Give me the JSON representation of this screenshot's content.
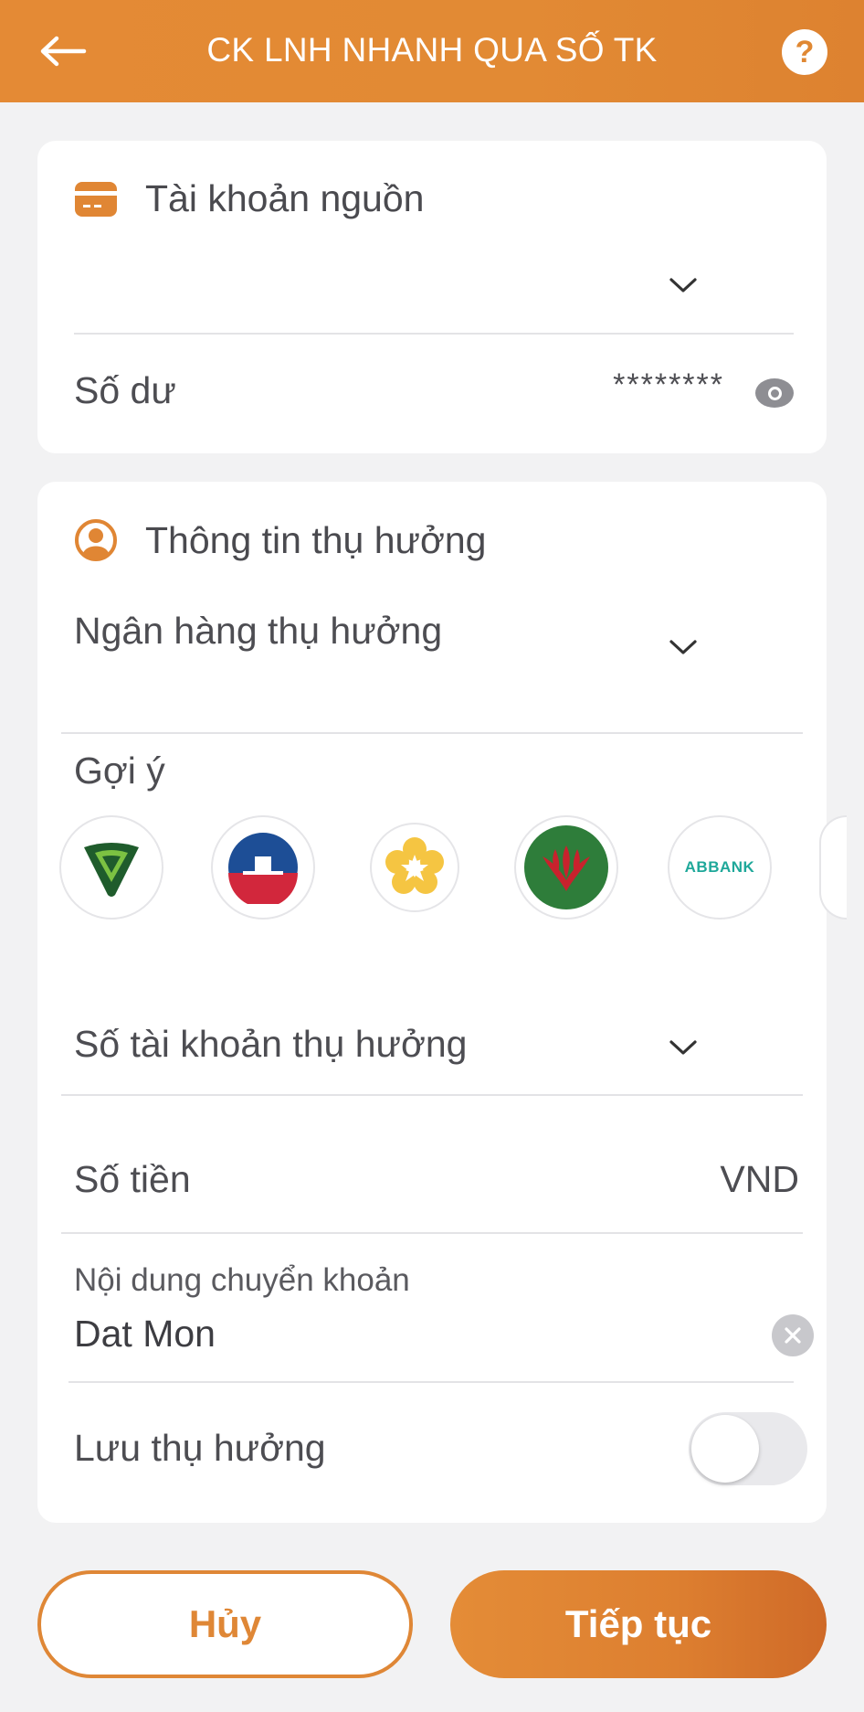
{
  "header": {
    "title": "CK LNH NHANH QUA SỐ TK",
    "help_label": "?"
  },
  "source_account": {
    "section_title": "Tài khoản nguồn",
    "balance_label": "Số dư",
    "balance_value": "********"
  },
  "beneficiary": {
    "section_title": "Thông tin thụ hưởng",
    "bank_placeholder": "Ngân hàng thụ hưởng",
    "suggest_label": "Gợi ý",
    "suggested_banks": [
      {
        "name": "vietcombank-logo"
      },
      {
        "name": "vietinbank-logo"
      },
      {
        "name": "flower-bank-logo"
      },
      {
        "name": "agribank-logo"
      },
      {
        "name": "abbank-logo",
        "text": "ABBANK"
      }
    ],
    "account_number_placeholder": "Số tài khoản thụ hưởng",
    "amount_label": "Số tiền",
    "currency": "VND",
    "content_label": "Nội dung chuyển khoản",
    "content_value": "Dat Mon",
    "save_label": "Lưu thụ hưởng",
    "save_enabled": false
  },
  "actions": {
    "cancel_label": "Hủy",
    "next_label": "Tiếp tục"
  },
  "colors": {
    "accent": "#e48a35",
    "background": "#f2f2f3"
  }
}
